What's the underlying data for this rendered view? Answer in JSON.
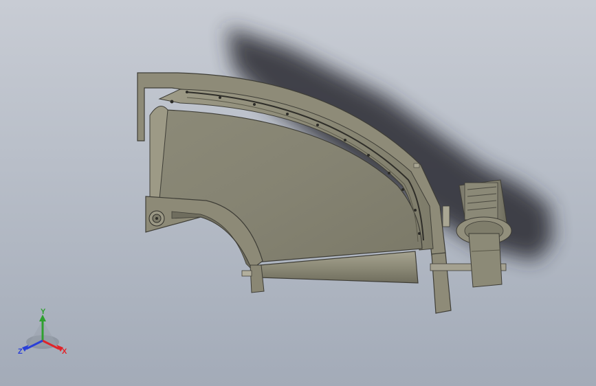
{
  "viewport": {
    "background_top": "#c8ccd4",
    "background_bottom": "#a3abb8",
    "model_color": "#8f8c78",
    "shadow_color": "#2a2c30"
  },
  "triad": {
    "x_label": "X",
    "y_label": "Y",
    "z_label": "Z",
    "x_color": "#e0242a",
    "y_color": "#2fa02f",
    "z_color": "#2a40d8"
  }
}
